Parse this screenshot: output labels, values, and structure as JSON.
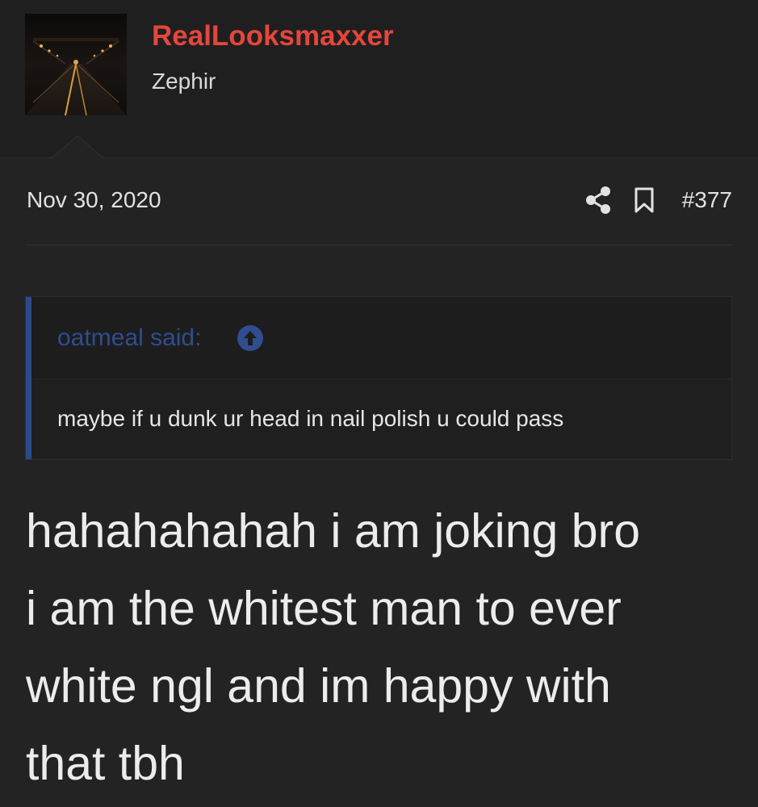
{
  "user": {
    "username": "RealLooksmaxxer",
    "title": "Zephir",
    "avatar_icon": "avatar-night-road-image"
  },
  "post": {
    "date": "Nov 30, 2020",
    "number": "#377",
    "share_icon": "share-icon",
    "bookmark_icon": "bookmark-icon"
  },
  "quote": {
    "author": "oatmeal said:",
    "jump_icon": "arrow-up-circle-icon",
    "text": "maybe if u dunk ur head in nail polish u could pass"
  },
  "body": {
    "lines": [
      "hahahahahah i am joking bro",
      "i am the whitest man to ever",
      "white ngl and im happy with",
      "that tbh"
    ]
  },
  "colors": {
    "background": "#232324",
    "username": "#e5463c",
    "quote_accent": "#2c4a8c",
    "text": "#ececec"
  }
}
